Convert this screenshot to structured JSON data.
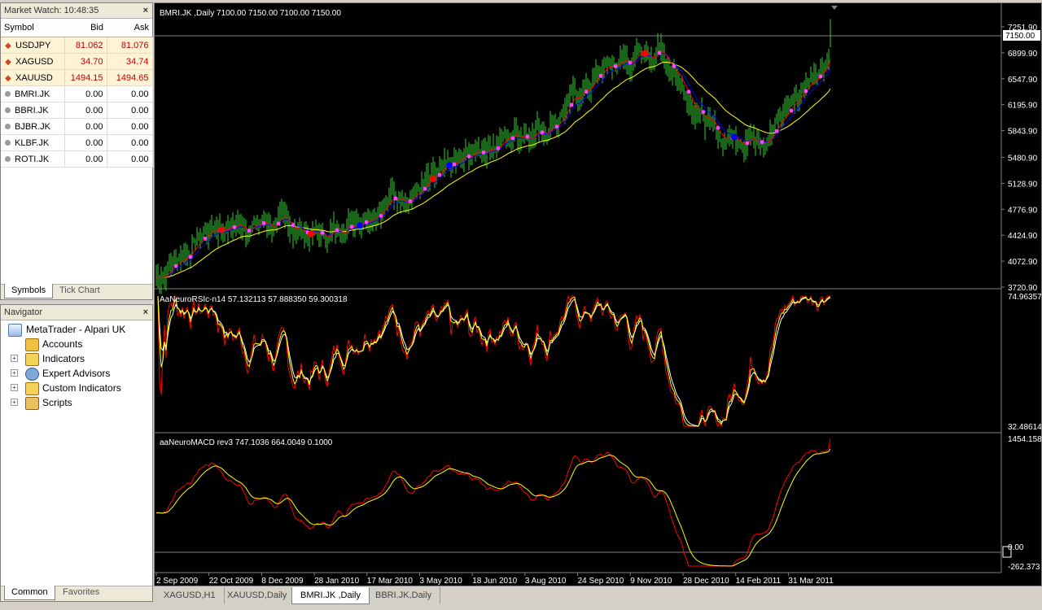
{
  "market_watch": {
    "title": "Market Watch: 10:48:35",
    "headers": {
      "symbol": "Symbol",
      "bid": "Bid",
      "ask": "Ask"
    },
    "rows": [
      {
        "symbol": "USDJPY",
        "bid": "81.062",
        "ask": "81.076",
        "kind": "fx"
      },
      {
        "symbol": "XAGUSD",
        "bid": "34.70",
        "ask": "34.74",
        "kind": "fx"
      },
      {
        "symbol": "XAUUSD",
        "bid": "1494.15",
        "ask": "1494.65",
        "kind": "fx"
      },
      {
        "symbol": "BMRI.JK",
        "bid": "0.00",
        "ask": "0.00",
        "kind": "stock"
      },
      {
        "symbol": "BBRI.JK",
        "bid": "0.00",
        "ask": "0.00",
        "kind": "stock"
      },
      {
        "symbol": "BJBR.JK",
        "bid": "0.00",
        "ask": "0.00",
        "kind": "stock"
      },
      {
        "symbol": "KLBF.JK",
        "bid": "0.00",
        "ask": "0.00",
        "kind": "stock"
      },
      {
        "symbol": "ROTI.JK",
        "bid": "0.00",
        "ask": "0.00",
        "kind": "stock"
      }
    ],
    "tabs": {
      "symbols": "Symbols",
      "tick_chart": "Tick Chart"
    }
  },
  "navigator": {
    "title": "Navigator",
    "root": "MetaTrader - Alpari UK",
    "items": [
      "Accounts",
      "Indicators",
      "Expert Advisors",
      "Custom Indicators",
      "Scripts"
    ],
    "tabs": {
      "common": "Common",
      "favorites": "Favorites"
    }
  },
  "chart": {
    "main_label": "BMRI.JK ,Daily  7100.00 7150.00 7100.00 7150.00",
    "rsi_label": "AaNeuroRSIc-n14 57.132113 57.888350 59.300318",
    "macd_label": "aaNeuroMACD rev3 747.1036 664.0049 0.1000",
    "current_price": "7150.00",
    "price_ticks": [
      "7251.90",
      "6899.90",
      "6547.90",
      "6195.90",
      "5843.90",
      "5480.90",
      "5128.90",
      "4776.90",
      "4424.90",
      "4072.90",
      "3720.90"
    ],
    "rsi_ticks": [
      "74.96357",
      "32.48614"
    ],
    "macd_ticks": [
      "1454.158",
      "0.00",
      "-262.373"
    ],
    "date_ticks": [
      "2 Sep 2009",
      "22 Oct 2009",
      "8 Dec 2009",
      "28 Jan 2010",
      "17 Mar 2010",
      "3 May 2010",
      "18 Jun 2010",
      "3 Aug 2010",
      "24 Sep 2010",
      "9 Nov 2010",
      "28 Dec 2010",
      "14 Feb 2011",
      "31 Mar 2011"
    ],
    "colors": {
      "bars": "#32cd32",
      "ma_slow": "#ffff00",
      "ma_fast": "#ff0000",
      "ma_mid": "#0000ff",
      "grid": "#808080"
    }
  },
  "chart_data": {
    "type": "line",
    "title": "BMRI.JK ,Daily",
    "xlabel": "",
    "ylabel": "",
    "x": [
      "2 Sep 2009",
      "22 Oct 2009",
      "8 Dec 2009",
      "28 Jan 2010",
      "17 Mar 2010",
      "3 May 2010",
      "18 Jun 2010",
      "3 Aug 2010",
      "24 Sep 2010",
      "9 Nov 2010",
      "28 Dec 2010",
      "14 Feb 2011",
      "31 Mar 2011"
    ],
    "series": [
      {
        "values": [
          3850,
          4550,
          4600,
          4400,
          4900,
          5150,
          5700,
          5950,
          6700,
          6950,
          5700,
          5900,
          6950
        ]
      },
      {
        "values": [
          3800,
          4500,
          4550,
          4450,
          4700,
          5100,
          5550,
          5900,
          6400,
          6900,
          6100,
          5900,
          6700
        ]
      }
    ],
    "ylim": [
      3720.9,
      7251.9
    ],
    "current_close": 7150,
    "rsi": {
      "ylim": [
        32.48614,
        74.96357
      ],
      "last": [
        57.132113,
        57.88835,
        59.300318
      ]
    },
    "macd": {
      "ylim": [
        -262.373,
        1454.158
      ],
      "last": [
        747.1036,
        664.0049,
        0.1
      ]
    }
  },
  "chart_tabs": [
    "XAGUSD,H1",
    "XAUUSD,Daily",
    "BMRI.JK ,Daily",
    "BBRI.JK,Daily"
  ],
  "active_chart_tab": "BMRI.JK ,Daily"
}
